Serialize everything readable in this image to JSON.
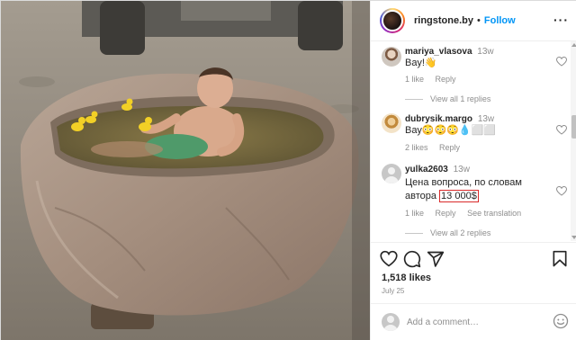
{
  "post": {
    "username": "ringstone.by",
    "separator": "•",
    "follow_label": "Follow",
    "more_label": "···",
    "likes": "1,518 likes",
    "date": "July 25",
    "add_comment_placeholder": "Add a comment…"
  },
  "comments": [
    {
      "username": "mariya_vlasova",
      "time": "13w",
      "text": "Вау!👋",
      "likes": "1 like",
      "reply": "Reply",
      "view_replies": "View all 1 replies"
    },
    {
      "username": "dubrysik.margo",
      "time": "13w",
      "text": "Вау😳😳😳💧⬜⬜",
      "likes": "2 likes",
      "reply": "Reply"
    },
    {
      "username": "yulka2603",
      "time": "13w",
      "text_before": "Цена вопроса, по словам автора ",
      "text_highlight": "13 000$",
      "likes": "1 like",
      "reply": "Reply",
      "see_translation": "See translation",
      "view_replies": "View all 2 replies"
    }
  ],
  "colors": {
    "accent": "#0095f6",
    "highlight_border": "#d92a2a",
    "secondary_text": "#8e8e8e"
  },
  "icons": [
    "heart-icon",
    "comment-icon",
    "share-icon",
    "bookmark-icon",
    "emoji-icon",
    "more-icon"
  ]
}
